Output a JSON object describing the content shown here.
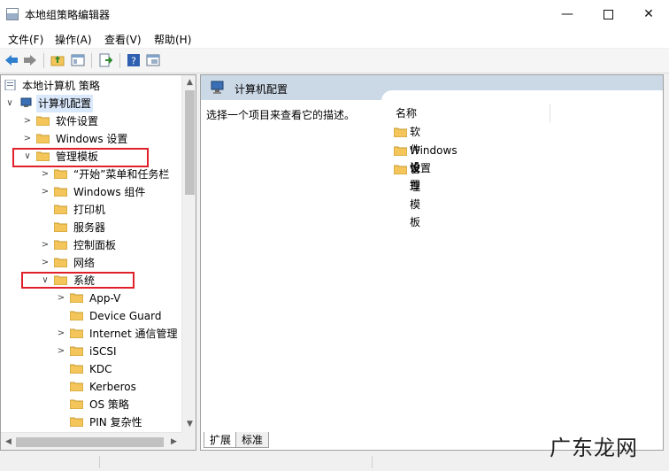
{
  "window": {
    "title": "本地组策略编辑器",
    "minimize_glyph": "—",
    "close_glyph": "✕"
  },
  "menubar": [
    {
      "label": "文件(F)"
    },
    {
      "label": "操作(A)"
    },
    {
      "label": "查看(V)"
    },
    {
      "label": "帮助(H)"
    }
  ],
  "toolbar": {
    "icons": [
      "back-arrow-icon",
      "forward-arrow-icon",
      "up-folder-icon",
      "show-hide-tree-icon",
      "export-list-icon",
      "help-icon",
      "properties-view-icon"
    ]
  },
  "tree": {
    "root": {
      "label": "本地计算机 策略"
    },
    "computer_config": {
      "label": "计算机配置",
      "chevron": "∨"
    },
    "nodes": [
      {
        "label": "软件设置",
        "chevron": ">"
      },
      {
        "label": "Windows 设置",
        "chevron": ">"
      },
      {
        "label": "管理模板",
        "chevron": "∨"
      },
      {
        "label": "“开始”菜单和任务栏",
        "chevron": ">"
      },
      {
        "label": "Windows 组件",
        "chevron": ">"
      },
      {
        "label": "打印机",
        "chevron": ""
      },
      {
        "label": "服务器",
        "chevron": ""
      },
      {
        "label": "控制面板",
        "chevron": ">"
      },
      {
        "label": "网络",
        "chevron": ">"
      },
      {
        "label": "系统",
        "chevron": "∨"
      },
      {
        "label": "App-V",
        "chevron": ">"
      },
      {
        "label": "Device Guard",
        "chevron": ""
      },
      {
        "label": "Internet 通信管理",
        "chevron": ">"
      },
      {
        "label": "iSCSI",
        "chevron": ">"
      },
      {
        "label": "KDC",
        "chevron": ""
      },
      {
        "label": "Kerberos",
        "chevron": ""
      },
      {
        "label": "OS 策略",
        "chevron": ""
      },
      {
        "label": "PIN 复杂性",
        "chevron": ""
      }
    ],
    "highlight_color": "#e0212a"
  },
  "scroll": {
    "up": "▲",
    "down": "▼",
    "left": "◀",
    "right": "▶"
  },
  "details": {
    "header_title": "计算机配置",
    "description": "选择一个项目来查看它的描述。",
    "column_name": "名称",
    "items": [
      {
        "label": "软件设置"
      },
      {
        "label": "Windows 设置"
      },
      {
        "label": "管理模板"
      }
    ]
  },
  "tabs": [
    {
      "label": "扩展",
      "active": true
    },
    {
      "label": "标准",
      "active": false
    }
  ],
  "watermark": {
    "text": "广东龙网"
  },
  "colors": {
    "folder": "#f3c55a",
    "header_band": "#cbd8e6",
    "selection": "#d9e8fb"
  }
}
